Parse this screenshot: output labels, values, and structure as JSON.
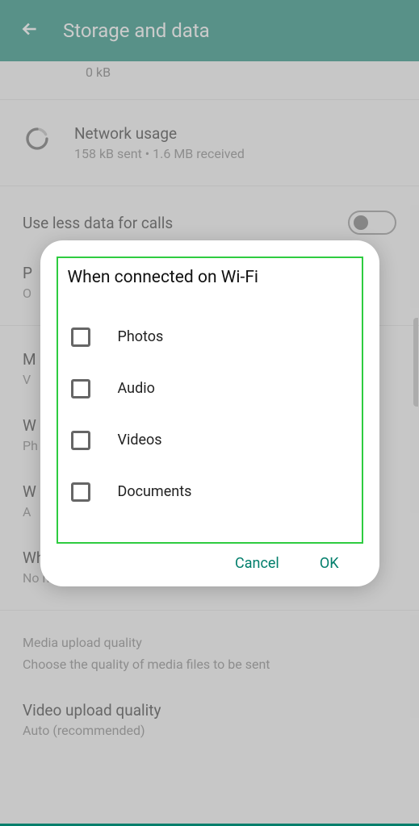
{
  "header": {
    "title": "Storage and data"
  },
  "storageSub": "0 kB",
  "network": {
    "title": "Network usage",
    "sub": "158 kB sent • 1.6 MB received"
  },
  "useLessData": "Use less data for calls",
  "proxy": {
    "title": "P",
    "sub": "O"
  },
  "mediaAuto": {
    "title": "M",
    "sub": "V"
  },
  "wifi": {
    "title": "W",
    "sub": "Ph"
  },
  "roam2": {
    "title": "W",
    "sub": "A"
  },
  "roaming": {
    "title": "When roaming",
    "sub": "No media"
  },
  "uploadSection": {
    "label": "Media upload quality",
    "sub": "Choose the quality of media files to be sent"
  },
  "videoQuality": {
    "title": "Video upload quality",
    "sub": "Auto (recommended)"
  },
  "dialog": {
    "title": "When connected on Wi-Fi",
    "options": [
      "Photos",
      "Audio",
      "Videos",
      "Documents"
    ],
    "cancel": "Cancel",
    "ok": "OK"
  }
}
